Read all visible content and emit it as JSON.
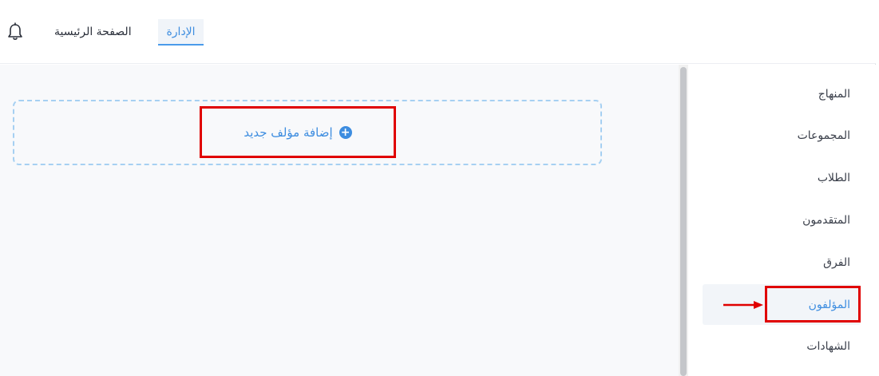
{
  "header": {
    "nav": {
      "home_label": "الصفحة الرئيسية",
      "admin_label": "الإدارة"
    },
    "notification_icon": "bell-icon"
  },
  "main": {
    "add_author_label": "إضافة مؤلف جديد",
    "add_icon": "plus-circle-icon"
  },
  "sidebar": {
    "items": [
      {
        "label": "المنهاج"
      },
      {
        "label": "المجموعات"
      },
      {
        "label": "الطلاب"
      },
      {
        "label": "المتقدمون"
      },
      {
        "label": "الفرق"
      },
      {
        "label": "المؤلفون",
        "active": true
      },
      {
        "label": "الشهادات"
      }
    ]
  },
  "colors": {
    "accent": "#3d8de0",
    "highlight": "#e00000",
    "dashed_border": "#a6d0f2"
  }
}
